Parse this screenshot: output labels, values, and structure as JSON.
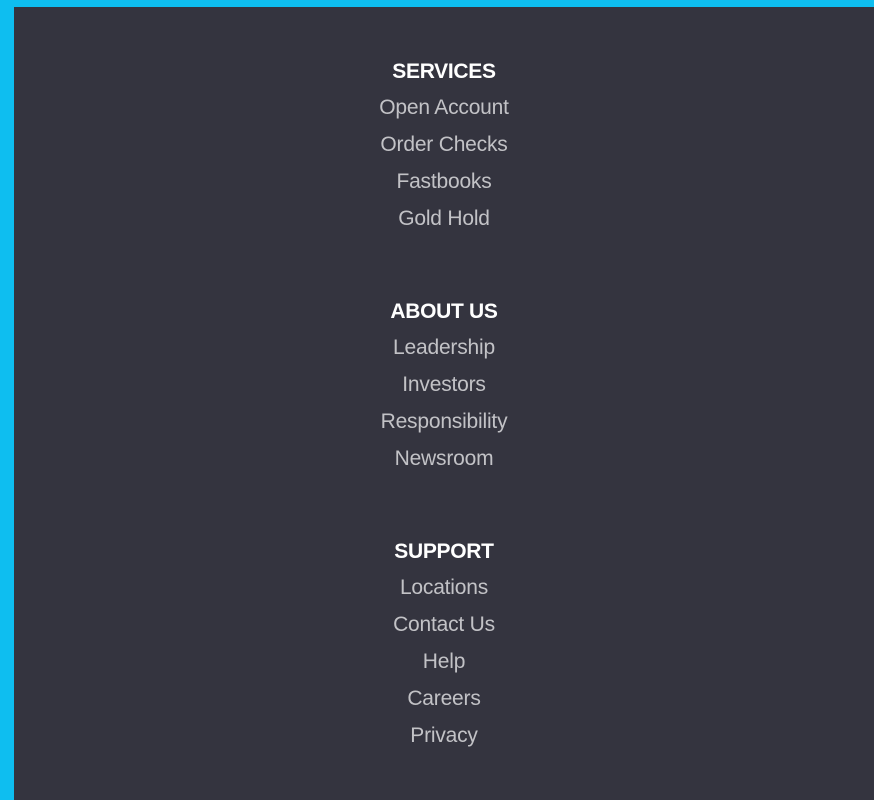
{
  "colors": {
    "border_accent": "#0ebef0",
    "panel_background": "#34343f",
    "heading_text": "#ffffff",
    "link_text": "#c2c2c6"
  },
  "footer": {
    "services": {
      "title": "SERVICES",
      "links": [
        "Open Account",
        "Order Checks",
        "Fastbooks",
        "Gold Hold"
      ]
    },
    "about": {
      "title": "ABOUT US",
      "links": [
        "Leadership",
        "Investors",
        "Responsibility",
        "Newsroom"
      ]
    },
    "support": {
      "title": "SUPPORT",
      "links": [
        "Locations",
        "Contact Us",
        "Help",
        "Careers",
        "Privacy"
      ]
    }
  }
}
